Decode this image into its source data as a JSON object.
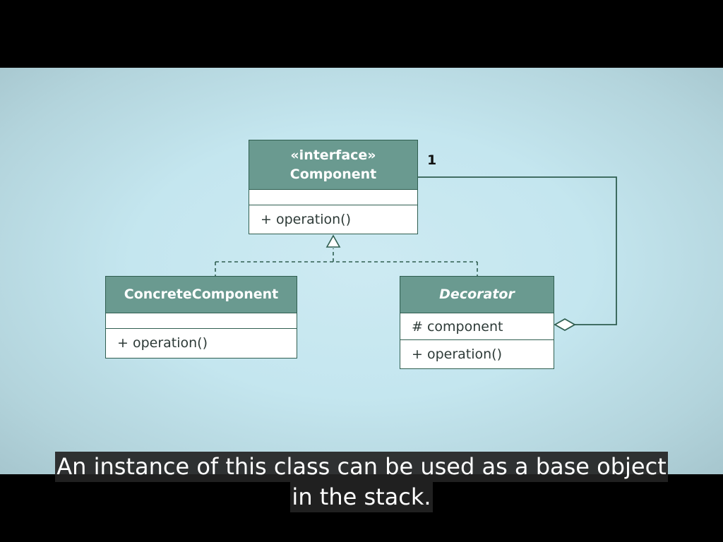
{
  "diagram": {
    "component": {
      "stereotype": "«interface»",
      "name": "Component",
      "operation": "+ operation()",
      "multiplicity": "1"
    },
    "concrete_component": {
      "name": "ConcreteComponent",
      "operation": "+ operation()"
    },
    "decorator": {
      "name": "Decorator",
      "attribute": "# component",
      "operation": "+ operation()"
    },
    "colors": {
      "header_fill": "#6a9a90",
      "border": "#2f5e50",
      "background": "#c4e6ef"
    }
  },
  "subtitle": {
    "line1": "An instance of this class can be used as a base object",
    "line2": "in the stack."
  }
}
